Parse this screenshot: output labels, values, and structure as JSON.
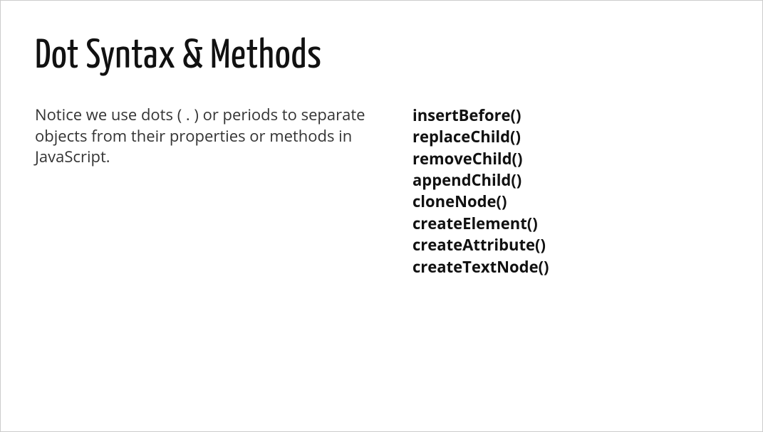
{
  "title": "Dot Syntax & Methods",
  "description": "Notice we use dots ( . ) or periods to separate objects from their properties or methods in JavaScript.",
  "methods": [
    "insertBefore()",
    "replaceChild()",
    "removeChild()",
    "appendChild()",
    "cloneNode()",
    "createElement()",
    "createAttribute()",
    "createTextNode()"
  ]
}
